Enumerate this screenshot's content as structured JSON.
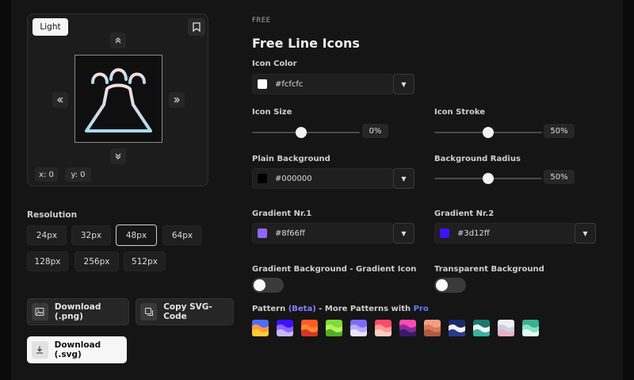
{
  "preview": {
    "light_label": "Light",
    "coord_x": "x: 0",
    "coord_y": "y: 0"
  },
  "resolution": {
    "label": "Resolution",
    "options": [
      "24px",
      "32px",
      "48px",
      "64px",
      "128px",
      "256px",
      "512px"
    ],
    "selected": "48px"
  },
  "actions": {
    "download_png": "Download (.png)",
    "copy_svg": "Copy SVG-Code",
    "download_svg": "Download (.svg)"
  },
  "header": {
    "badge": "FREE",
    "title": "Free Line Icons"
  },
  "icon_color": {
    "label": "Icon Color",
    "value": "#fcfcfc",
    "color": "#fcfcfc"
  },
  "icon_size": {
    "label": "Icon Size",
    "value": "0%",
    "level": 0.45
  },
  "icon_stroke": {
    "label": "Icon Stroke",
    "value": "50%",
    "level": 0.5
  },
  "plain_bg": {
    "label": "Plain Background",
    "value": "#000000",
    "color": "#000000"
  },
  "bg_radius": {
    "label": "Background Radius",
    "value": "50%",
    "level": 0.5
  },
  "gradient1": {
    "label": "Gradient Nr.1",
    "value": "#8f66ff",
    "color": "#8f66ff"
  },
  "gradient2": {
    "label": "Gradient Nr.2",
    "value": "#3d12ff",
    "color": "#3d12ff"
  },
  "gradient_toggle": {
    "label": "Gradient Background - Gradient Icon"
  },
  "transparent_toggle": {
    "label": "Transparent Background"
  },
  "pattern": {
    "label_pre": "Pattern ",
    "label_beta": "(Beta)",
    "label_mid": " - More Patterns with ",
    "label_pro": "Pro",
    "swatches": [
      [
        "#4f6bff",
        "#ff9a3d",
        "#ffcc33"
      ],
      [
        "#3d12ff",
        "#8f66ff",
        "#c7b8ff"
      ],
      [
        "#ff5a2a",
        "#ff8a2a",
        "#d8352a"
      ],
      [
        "#7fdc3a",
        "#b7f05a",
        "#4fae2a"
      ],
      [
        "#7d6bff",
        "#b8aaff",
        "#e8e4ff"
      ],
      [
        "#ff4a6b",
        "#ff9a9a",
        "#ffd0c0"
      ],
      [
        "#ff4ab0",
        "#8a2a9a",
        "#3a1a6a"
      ],
      [
        "#f0a080",
        "#d87a5a",
        "#b05a40"
      ],
      [
        "#1a2a6a",
        "#f2f2f2",
        "#2a3a8a"
      ],
      [
        "#1a7a6a",
        "#f2f2f2",
        "#3ab0a0"
      ],
      [
        "#f0f0f0",
        "#c8d0e0",
        "#e8b0c0"
      ],
      [
        "#3ab090",
        "#8ae0c0",
        "#e0fff0"
      ]
    ]
  }
}
